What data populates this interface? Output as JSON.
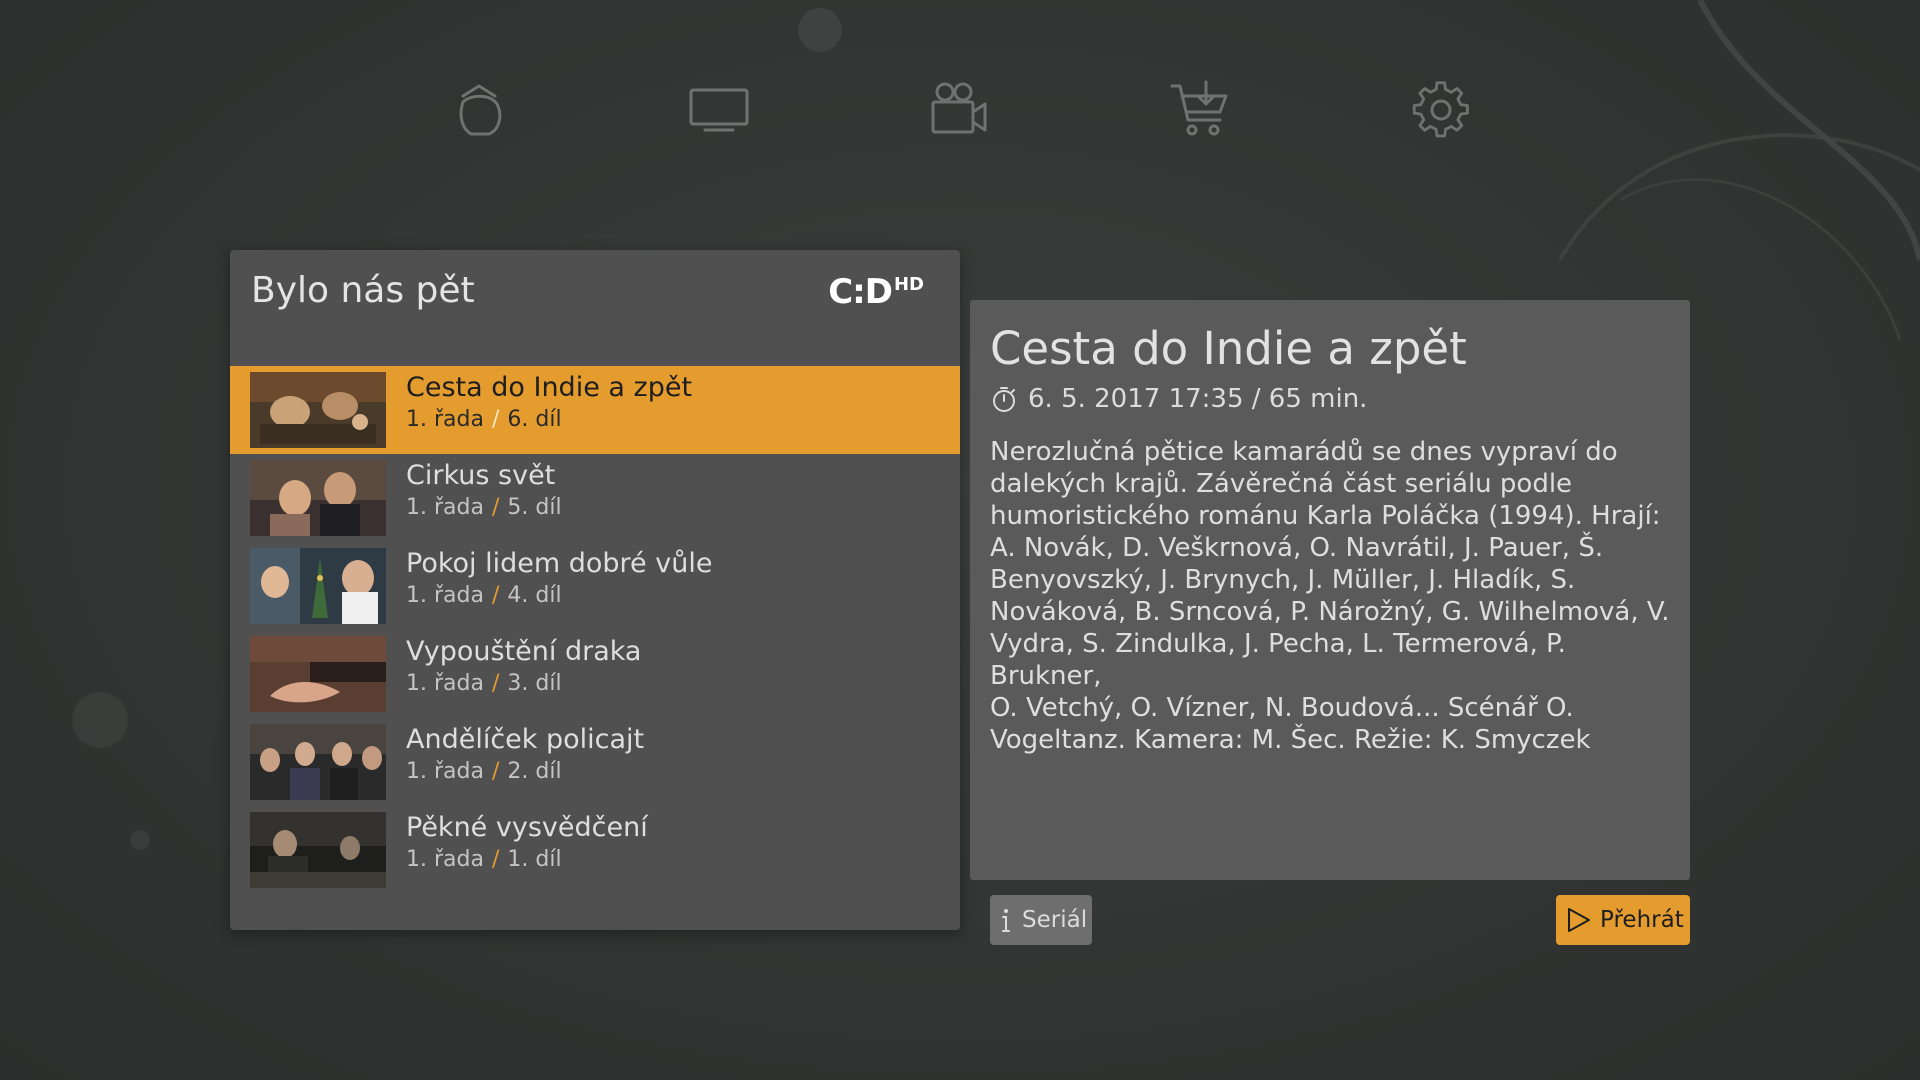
{
  "colors": {
    "accent": "#e59c2e",
    "panel": "#505050",
    "detail_panel": "#5a5a5a",
    "background": "#333634"
  },
  "nav": {
    "items": [
      {
        "name": "home",
        "icon": "home-icon"
      },
      {
        "name": "tv",
        "icon": "tv-icon"
      },
      {
        "name": "video",
        "icon": "video-camera-icon"
      },
      {
        "name": "shop",
        "icon": "cart-icon"
      },
      {
        "name": "settings",
        "icon": "gear-icon"
      }
    ]
  },
  "list": {
    "title": "Bylo nás pět",
    "channel_logo": {
      "main": "C:D",
      "suffix": "HD"
    },
    "episodes": [
      {
        "title": "Cesta do Indie a zpět",
        "series": "1. řada",
        "episode": "6. díl",
        "selected": true
      },
      {
        "title": "Cirkus svět",
        "series": "1. řada",
        "episode": "5. díl",
        "selected": false
      },
      {
        "title": "Pokoj lidem dobré vůle",
        "series": "1. řada",
        "episode": "4. díl",
        "selected": false
      },
      {
        "title": "Vypouštění draka",
        "series": "1. řada",
        "episode": "3. díl",
        "selected": false
      },
      {
        "title": "Andělíček policajt",
        "series": "1. řada",
        "episode": "2. díl",
        "selected": false
      },
      {
        "title": "Pěkné vysvědčení",
        "series": "1. řada",
        "episode": "1. díl",
        "selected": false
      }
    ]
  },
  "detail": {
    "title": "Cesta do Indie a zpět",
    "meta": "6. 5. 2017 17:35 / 65 min.",
    "description_lines": [
      "Nerozlučná pětice kamarádů se dnes vypraví do",
      "dalekých krajů. Závěrečná část seriálu podle",
      "humoristického románu Karla Poláčka (1994). Hrají:",
      "A. Novák, D. Veškrnová, O. Navrátil, J. Pauer, Š.",
      "Benyovszký, J. Brynych, J. Müller, J. Hladík, S.",
      "Nováková, B. Srncová, P. Nárožný, G. Wilhelmová, V.",
      "Vydra, S. Zindulka, J. Pecha, L. Termerová, P. Brukner,",
      "O. Vetchý, O. Vízner, N. Boudová... Scénář O.",
      "Vogeltanz. Kamera: M. Šec. Režie: K. Smyczek"
    ]
  },
  "buttons": {
    "serial_label": "Seriál",
    "play_label": "Přehrát"
  }
}
